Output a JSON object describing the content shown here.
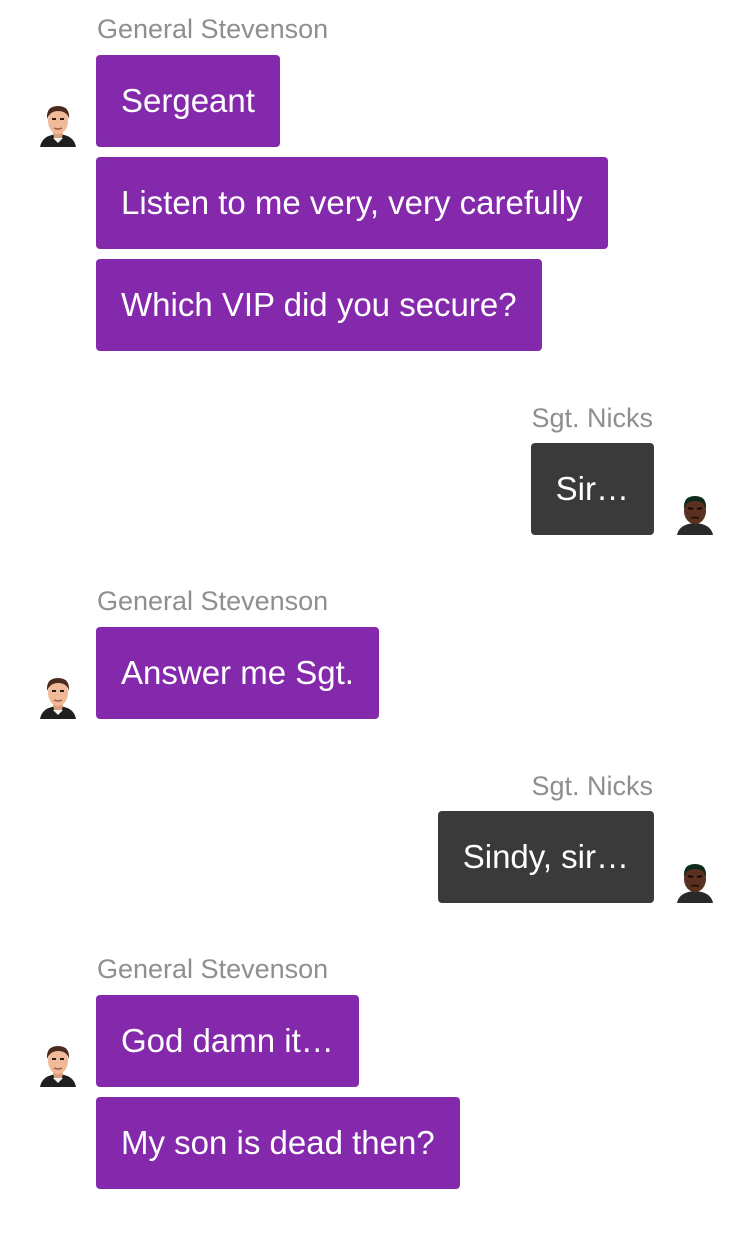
{
  "colors": {
    "general_bubble": "#8429ab",
    "sergeant_bubble": "#3a3a3a",
    "sender_label": "#8e8e93",
    "background": "#ffffff"
  },
  "chat": {
    "group1": {
      "sender": "General Stevenson",
      "avatar_icon": "general-avatar-icon",
      "messages": [
        "Sergeant",
        "Listen to me very, very carefully",
        "Which VIP did you secure?"
      ]
    },
    "group2": {
      "sender": "Sgt. Nicks",
      "avatar_icon": "sergeant-avatar-icon",
      "messages": [
        "Sir…"
      ]
    },
    "group3": {
      "sender": "General Stevenson",
      "avatar_icon": "general-avatar-icon",
      "messages": [
        "Answer me Sgt."
      ]
    },
    "group4": {
      "sender": "Sgt. Nicks",
      "avatar_icon": "sergeant-avatar-icon",
      "messages": [
        "Sindy, sir…"
      ]
    },
    "group5": {
      "sender": "General Stevenson",
      "avatar_icon": "general-avatar-icon",
      "messages": [
        "God damn it…",
        "My son is dead then?"
      ]
    }
  }
}
